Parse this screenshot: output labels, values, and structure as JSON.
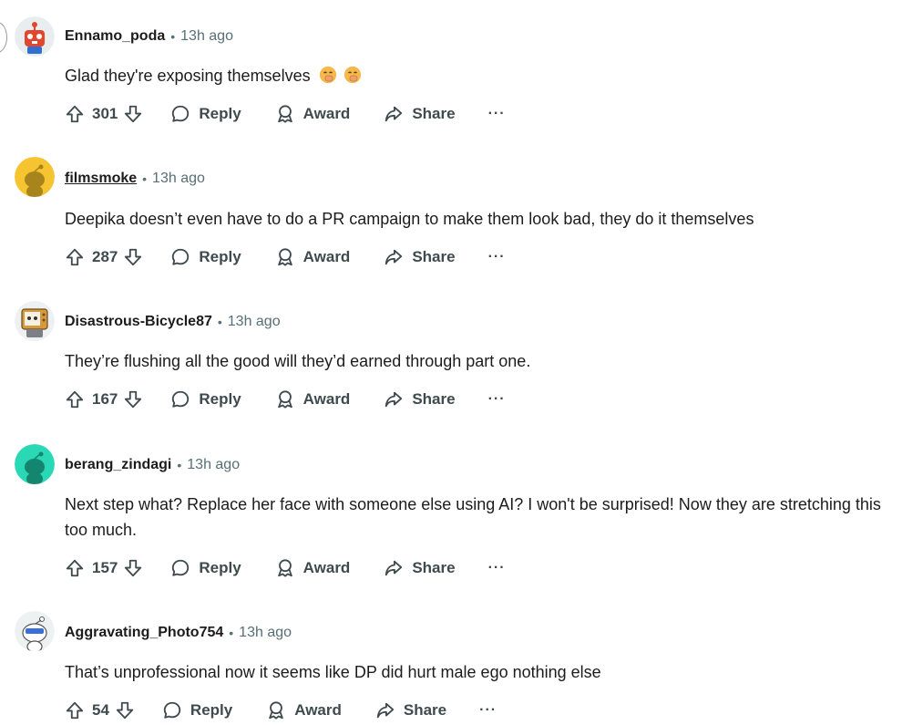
{
  "colors": {
    "meta": "#576f76",
    "text": "#1c1c1c",
    "action": "#3f4a4e"
  },
  "comments": [
    {
      "author": "Ennamo_poda",
      "time": "13h ago",
      "body": "Glad they're exposing themselves",
      "emoji": [
        "face-with-hand-over-mouth",
        "face-with-hand-over-mouth"
      ],
      "votes": "301",
      "avatar": "red-robot-snoo"
    },
    {
      "author": "filmsmoke",
      "time": "13h ago",
      "body": "Deepika doesn’t even have to do a PR campaign to make them look bad, they do it themselves",
      "votes": "287",
      "avatar": "yellow-snoo"
    },
    {
      "author": "Disastrous-Bicycle87",
      "time": "13h ago",
      "body": "They’re flushing all the good will they’d earned through part one.",
      "votes": "167",
      "avatar": "tv-snoo"
    },
    {
      "author": "berang_zindagi",
      "time": "13h ago",
      "body": "Next step what? Replace her face with someone else using AI? I won't be surprised! Now they are stretching this too much.",
      "votes": "157",
      "avatar": "teal-snoo"
    },
    {
      "author": "Aggravating_Photo754",
      "time": "13h ago",
      "body": "That’s unprofessional now it seems like DP did hurt male ego nothing else",
      "votes": "54",
      "avatar": "sunglasses-snoo"
    }
  ],
  "actions": {
    "reply": "Reply",
    "award": "Award",
    "share": "Share",
    "more": "···"
  }
}
